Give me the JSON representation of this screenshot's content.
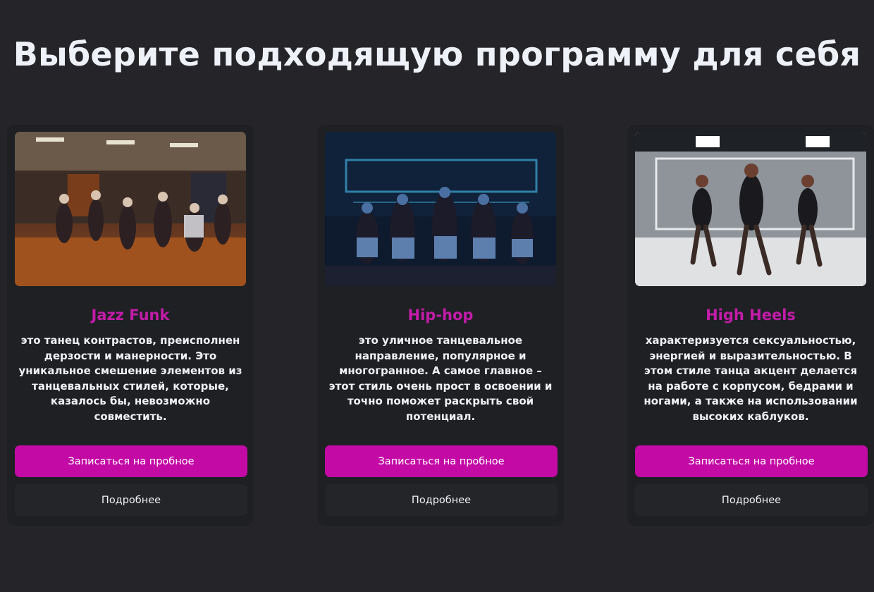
{
  "page": {
    "title": "Выберите подходящую программу для себя"
  },
  "cards": [
    {
      "image": "jazz-funk-dance-class-photo",
      "title": "Jazz Funk",
      "description": "это танец контрастов, преисполнен дерзости и манерности. Это уникальное смешение элементов из танцевальных стилей, которые, казалось бы, невозможно совместить.",
      "primary_button": "Записаться на пробное",
      "secondary_button": "Подробнее"
    },
    {
      "image": "hip-hop-stage-performance-photo",
      "title": "Hip-hop",
      "description": "это уличное танцевальное направление, популярное и многогранное. А самое главное – этот стиль очень прост в освоении и точно поможет раскрыть свой потенциал.",
      "primary_button": "Записаться на пробное",
      "secondary_button": "Подробнее"
    },
    {
      "image": "high-heels-dancers-photo",
      "title": "High Heels",
      "description": "характеризуется сексуальностью, энергией и выразительностью. В этом стиле танца акцент делается на работе с корпусом, бедрами и ногами, а также на использовании высоких каблуков.",
      "primary_button": "Записаться на пробное",
      "secondary_button": "Подробнее"
    }
  ],
  "colors": {
    "background": "#252529",
    "card": "#1e2024",
    "accent": "#c30aa5",
    "title_accent": "#c21ca8"
  }
}
